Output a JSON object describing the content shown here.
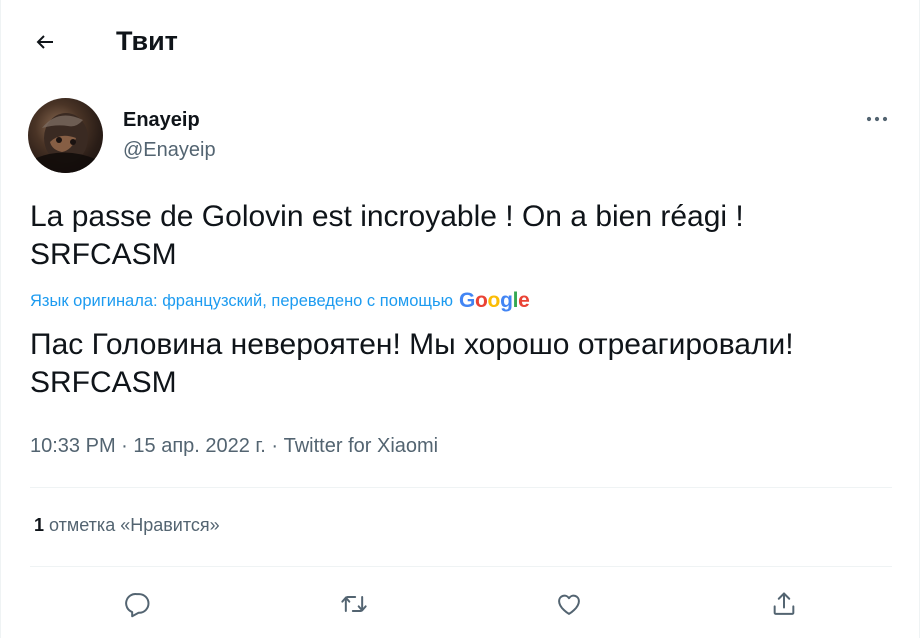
{
  "header": {
    "title": "Твит",
    "back_icon": "arrow-left-icon"
  },
  "author": {
    "display_name": "Enayeip",
    "handle": "@Enayeip"
  },
  "tweet": {
    "text": "La passe de Golovin est incroyable ! On a bien réagi ! SRFCASM",
    "translation_note": "Язык оригинала: французский, переведено с помощью",
    "translation_provider": "Google",
    "translated_text": "Пас Головина невероятен! Мы хорошо отреагировали! SRFCASM",
    "time": "10:33 PM",
    "separator": " · ",
    "date": "15 апр. 2022 г.",
    "source": "Twitter for Xiaomi"
  },
  "stats": {
    "likes_count": "1",
    "likes_label": "отметка «Нравится»"
  },
  "actions": {
    "reply_icon": "reply-icon",
    "retweet_icon": "retweet-icon",
    "like_icon": "heart-icon",
    "share_icon": "share-icon"
  },
  "colors": {
    "accent": "#1d9bf0",
    "text_primary": "#0f1419",
    "text_secondary": "#536471",
    "divider": "#eff3f4"
  }
}
